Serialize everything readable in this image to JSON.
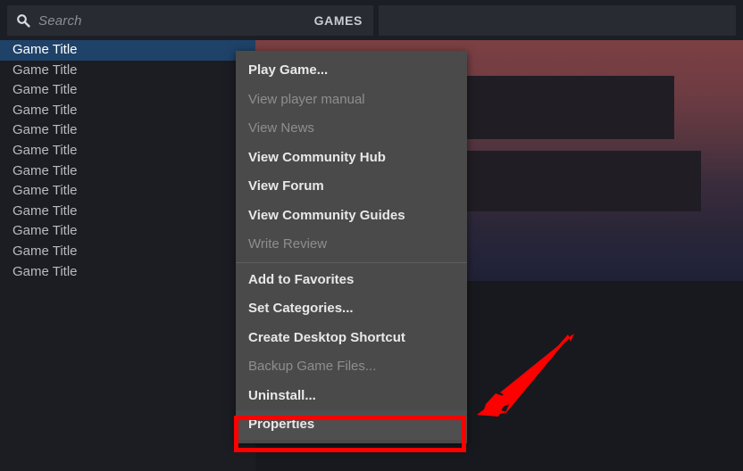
{
  "header": {
    "search": {
      "icon": "search-icon",
      "placeholder": "Search",
      "value": ""
    },
    "section_label": "GAMES"
  },
  "sidebar": {
    "games": [
      {
        "title": "Game Title",
        "selected": true
      },
      {
        "title": "Game Title",
        "selected": false
      },
      {
        "title": "Game Title",
        "selected": false
      },
      {
        "title": "Game Title",
        "selected": false
      },
      {
        "title": "Game Title",
        "selected": false
      },
      {
        "title": "Game Title",
        "selected": false
      },
      {
        "title": "Game Title",
        "selected": false
      },
      {
        "title": "Game Title",
        "selected": false
      },
      {
        "title": "Game Title",
        "selected": false
      },
      {
        "title": "Game Title",
        "selected": false
      },
      {
        "title": "Game Title",
        "selected": false
      },
      {
        "title": "Game Title",
        "selected": false
      }
    ]
  },
  "context_menu": {
    "groups": [
      {
        "items": [
          {
            "label": "Play Game...",
            "disabled": false,
            "highlighted": false
          },
          {
            "label": "View player manual",
            "disabled": true,
            "highlighted": false
          },
          {
            "label": "View News",
            "disabled": true,
            "highlighted": false
          },
          {
            "label": "View Community Hub",
            "disabled": false,
            "highlighted": false
          },
          {
            "label": "View Forum",
            "disabled": false,
            "highlighted": false
          },
          {
            "label": "View Community Guides",
            "disabled": false,
            "highlighted": false
          },
          {
            "label": "Write Review",
            "disabled": true,
            "highlighted": false
          }
        ]
      },
      {
        "items": [
          {
            "label": "Add to Favorites",
            "disabled": false,
            "highlighted": false
          },
          {
            "label": "Set Categories...",
            "disabled": false,
            "highlighted": false
          },
          {
            "label": "Create Desktop Shortcut",
            "disabled": false,
            "highlighted": false
          },
          {
            "label": "Backup Game Files...",
            "disabled": true,
            "highlighted": false
          },
          {
            "label": "Uninstall...",
            "disabled": false,
            "highlighted": false
          },
          {
            "label": "Properties",
            "disabled": false,
            "highlighted": true
          }
        ]
      }
    ]
  },
  "annotation": {
    "highlight_color": "#fd0000",
    "arrow_color": "#fd0000",
    "target_label": "Properties"
  },
  "colors": {
    "window_background": "#1b1d23",
    "content_background": "#17191e",
    "selection_blue": "#1f4268",
    "menu_background": "#4a4a4a",
    "banner_top": "#7c4043",
    "banner_bottom": "#202134"
  }
}
